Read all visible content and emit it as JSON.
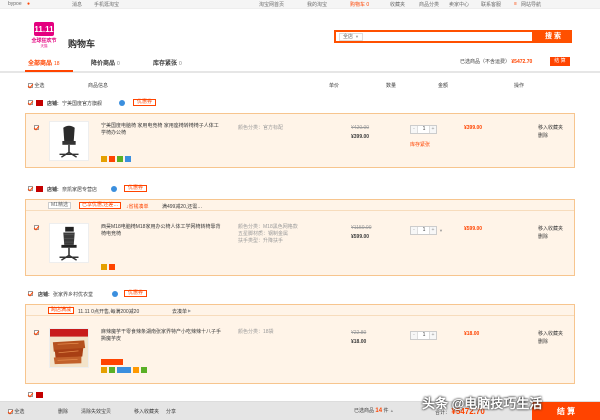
{
  "topbar": {
    "user": "bypoe",
    "items": [
      "消息",
      "手机逛淘宝",
      "淘宝网首页",
      "我的淘宝",
      "购物车 0",
      "收藏夹",
      "商品分类",
      "卖家中心",
      "联系客服",
      "网站导航"
    ]
  },
  "header": {
    "logo_line1": "11.11",
    "logo_line2": "全球狂欢节",
    "logo_line3": "天猫",
    "title": "购物车",
    "search_scope": "全店",
    "search_button": "搜 索"
  },
  "tabs": [
    {
      "label": "全部商品",
      "count": "18"
    },
    {
      "label": "降价商品",
      "count": "0"
    },
    {
      "label": "库存紧张",
      "count": "0"
    }
  ],
  "summary": {
    "label": "已选商品（不含运费）",
    "amount": "¥5472.70",
    "button": "结 算"
  },
  "columns": [
    "全选",
    "商品信息",
    "单价",
    "数量",
    "金额",
    "操作"
  ],
  "shops": [
    {
      "label": "店铺:",
      "name": "宁美国度官方旗舰",
      "coupon": "优惠券",
      "items": [
        {
          "title": "宁美国度电脑椅 家用电竞椅 家用座椅转椅椅子人体工学椅办公椅",
          "attrs": [
            "颜色分类：官方标配"
          ],
          "orig": "¥420.00",
          "price": "¥399.00",
          "qty": "1",
          "stock_tip": "库存紧张",
          "sum": "¥399.00",
          "ops": [
            "移入收藏夹",
            "删除"
          ]
        }
      ]
    },
    {
      "label": "店铺:",
      "name": "奈凯家居专营店",
      "coupon": "优惠券",
      "promo": {
        "tag": "M1精选",
        "deal_tag": "已享优惠,还差…",
        "deal": "↓省钱凑单",
        "text": "满499减20,还需…"
      },
      "items": [
        {
          "title": "西昊M18电脑椅M18家用办公椅人体工学网椅转椅靠背椅电竞椅",
          "attrs": [
            "颜色分类：M18黑色网格款",
            "五星脚材质：钢制金属",
            "扶手类型：升降扶手"
          ],
          "orig": "¥1150.00",
          "price": "¥599.00",
          "qty": "1",
          "sum": "¥599.00",
          "ops": [
            "移入收藏夹",
            "删除"
          ]
        }
      ]
    },
    {
      "label": "店铺:",
      "name": "张家界乡村优衣堂",
      "coupon": "优惠券",
      "promo": {
        "tag": "跨店满减",
        "text": "11.11 0点开售,每满200减20",
        "link": "去凑单"
      },
      "items": [
        {
          "title": "麻辣魔芋干零食辣条湖南张家界特产小吃辣辣十八子手撕魔芋皮",
          "attrs": [
            "颜色分类：18袋"
          ],
          "orig": "¥22.80",
          "price": "¥18.00",
          "qty": "1",
          "sum": "¥18.00",
          "ops": [
            "移入收藏夹",
            "删除"
          ]
        }
      ]
    }
  ],
  "bottom": {
    "select_all": "全选",
    "delete": "删除",
    "clear_invalid": "清除失效宝贝",
    "move_to_fav": "移入收藏夹",
    "share": "分享",
    "selected_label": "已选商品",
    "selected_count": "14",
    "selected_unit": "件",
    "total_label": "合计：",
    "total": "¥5472.70",
    "checkout": "结 算"
  },
  "watermark": "头条 @电脑技巧生活",
  "colors": {
    "accent": "#ff4400",
    "item_bg": "#fff4e8",
    "item_border": "#f7c58e"
  }
}
